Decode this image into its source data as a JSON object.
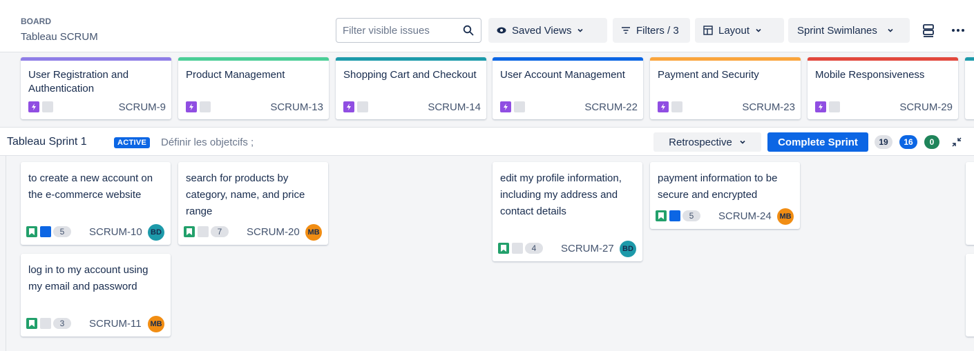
{
  "header": {
    "breadcrumb": "BOARD",
    "board_name": "Tableau SCRUM",
    "search_placeholder": "Filter visible issues",
    "saved_views": "Saved Views",
    "filters": "Filters / 3",
    "layout": "Layout",
    "swimlanes": "Sprint Swimlanes"
  },
  "epics": [
    {
      "title": "User Registration and Authentication",
      "key": "SCRUM-9",
      "color": "#8f7ee7"
    },
    {
      "title": "Product Management",
      "key": "SCRUM-13",
      "color": "#4bce97"
    },
    {
      "title": "Shopping Cart and Checkout",
      "key": "SCRUM-14",
      "color": "#1d9aaa"
    },
    {
      "title": "User Account Management",
      "key": "SCRUM-22",
      "color": "#0c66e4"
    },
    {
      "title": "Payment and Security",
      "key": "SCRUM-23",
      "color": "#faa53d"
    },
    {
      "title": "Mobile Responsiveness",
      "key": "SCRUM-29",
      "color": "#e2483d"
    }
  ],
  "sprint": {
    "name": "Tableau Sprint 1",
    "status": "ACTIVE",
    "goals": "Définir les objetcifs ;",
    "retrospective": "Retrospective",
    "complete": "Complete Sprint",
    "counts": {
      "todo": "19",
      "in_progress": "16",
      "done": "0"
    }
  },
  "cards": [
    {
      "summary": "to create a new account on the e-commerce website",
      "points": "5",
      "key": "SCRUM-10",
      "assignee": "BD"
    },
    {
      "summary": "log in to my account using my email and password",
      "points": "3",
      "key": "SCRUM-11",
      "assignee": "MB"
    },
    {
      "summary": "search for products by category, name, and price range",
      "points": "7",
      "key": "SCRUM-20",
      "assignee": "MB"
    },
    {
      "summary": "edit my profile information, including my address and contact details",
      "points": "4",
      "key": "SCRUM-27",
      "assignee": "BD"
    },
    {
      "summary": "payment information to be secure and encrypted",
      "points": "5",
      "key": "SCRUM-24",
      "assignee": "MB"
    }
  ],
  "colors": {
    "avatar_bd": "#1d9aaa",
    "avatar_mb": "#f18d13",
    "story": "#22a06b",
    "epic_chip": "#904ee2",
    "blue_chip": "#0c66e4"
  }
}
